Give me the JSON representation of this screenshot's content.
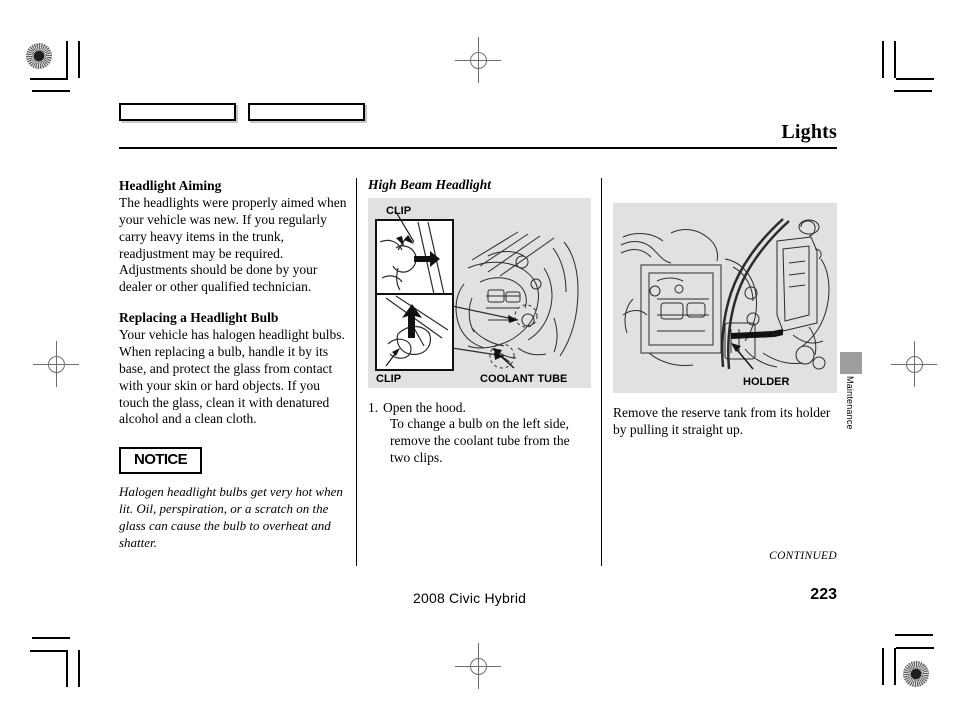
{
  "header": {
    "title": "Lights"
  },
  "spec_boxes": [
    {
      "name": "spec-box-left",
      "text": ""
    },
    {
      "name": "spec-box-right",
      "text": ""
    }
  ],
  "column_left": {
    "section_1": {
      "heading": "Headlight Aiming",
      "body": "The headlights were properly aimed when your vehicle was new. If you regularly carry heavy items in the trunk, readjustment may be required. Adjustments should be done by your dealer or other qualified technician."
    },
    "section_2": {
      "heading": "Replacing a Headlight Bulb",
      "body": "Your vehicle has halogen headlight bulbs. When replacing a bulb, handle it by its base, and protect the glass from contact with your skin or hard objects. If you touch the glass, clean it with denatured alcohol and a clean cloth."
    },
    "notice": {
      "label": "NOTICE",
      "body": "Halogen headlight bulbs get very hot when lit. Oil, perspiration, or a scratch on the glass can cause the bulb to overheat and shatter."
    }
  },
  "column_middle": {
    "figure": {
      "title": "High Beam Headlight",
      "callouts": {
        "clip_top": "CLIP",
        "clip_bottom": "CLIP",
        "coolant_tube": "COOLANT TUBE"
      }
    },
    "step": {
      "number": "1.",
      "line_1": "Open the hood.",
      "line_2": "To change a bulb on the left side, remove the coolant tube from the two clips."
    }
  },
  "column_right": {
    "figure": {
      "callouts": {
        "holder": "HOLDER"
      }
    },
    "body": "Remove the reserve tank from its holder by pulling it straight up."
  },
  "side_tab": {
    "label": "Maintenance"
  },
  "footer": {
    "continued": "CONTINUED",
    "model": "2008  Civic  Hybrid",
    "page_number": "223"
  },
  "colors": {
    "figure_background": "#e1e1e1",
    "thumb_tab": "#9e9e9e",
    "rule": "#000000"
  }
}
